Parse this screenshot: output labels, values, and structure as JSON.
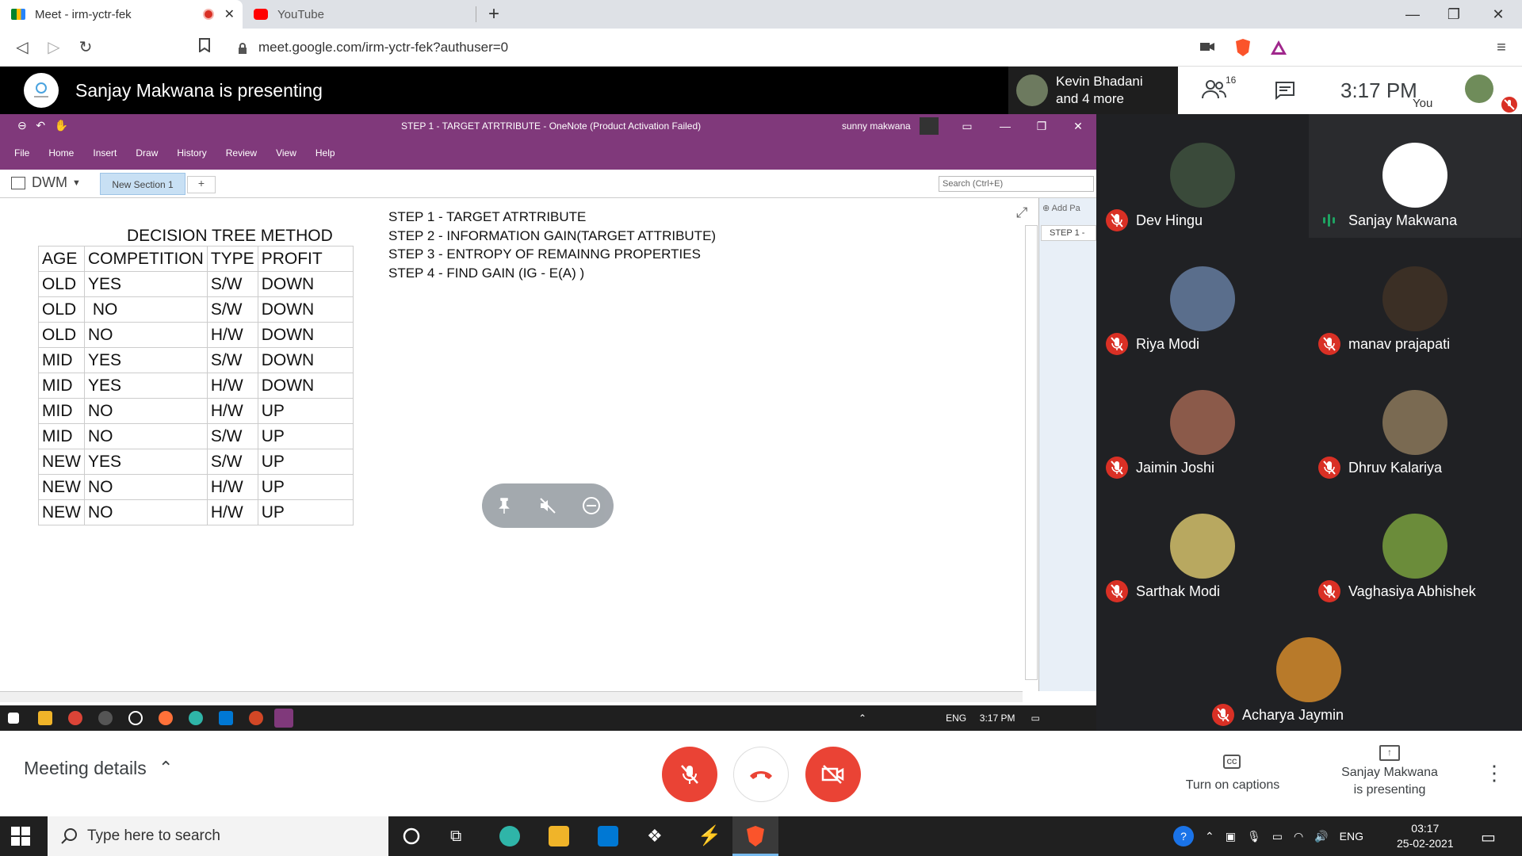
{
  "browser": {
    "tabs": [
      {
        "title": "Meet - irm-yctr-fek"
      },
      {
        "title": "YouTube"
      }
    ],
    "url": "meet.google.com/irm-yctr-fek?authuser=0"
  },
  "meet_header": {
    "presenting_title": "Sanjay Makwana is presenting",
    "pinned_name": "Kevin Bhadani",
    "pinned_more": "and 4 more",
    "people_count": "16",
    "clock": "3:17  PM",
    "you_label": "You"
  },
  "onenote": {
    "title": "STEP 1 -  TARGET ATRTRIBUTE  -  OneNote (Product Activation Failed)",
    "user": "sunny makwana",
    "menu": [
      "File",
      "Home",
      "Insert",
      "Draw",
      "History",
      "Review",
      "View",
      "Help"
    ],
    "notebook": "DWM",
    "section": "New Section 1",
    "search_placeholder": "Search (Ctrl+E)",
    "add_page": "Add Pa",
    "page_tab": "STEP 1 -",
    "page_title": "DECISION TREE METHOD",
    "table": {
      "headers": [
        "AGE",
        "COMPETITION",
        "TYPE",
        "PROFIT"
      ],
      "rows": [
        [
          "OLD",
          "YES",
          "S/W",
          "DOWN"
        ],
        [
          "OLD",
          " NO",
          "S/W",
          "DOWN"
        ],
        [
          "OLD",
          "NO",
          "H/W",
          "DOWN"
        ],
        [
          "MID",
          "YES",
          "S/W",
          "DOWN"
        ],
        [
          "MID",
          "YES",
          "H/W",
          "DOWN"
        ],
        [
          "MID",
          "NO",
          "H/W",
          "UP"
        ],
        [
          "MID",
          "NO",
          "S/W",
          "UP"
        ],
        [
          "NEW",
          "YES",
          "S/W",
          "UP"
        ],
        [
          "NEW",
          "NO",
          "H/W",
          "UP"
        ],
        [
          "NEW",
          "NO",
          "H/W",
          "UP"
        ]
      ]
    },
    "steps": [
      "STEP 1 -  TARGET ATRTRIBUTE",
      "STEP 2 - INFORMATION GAIN(TARGET ATTRIBUTE)",
      "STEP 3 - ENTROPY OF REMAINNG PROPERTIES",
      "STEP 4 - FIND GAIN (IG - E(A) )"
    ],
    "inner_taskbar": {
      "lang": "ENG",
      "time": "3:17 PM"
    }
  },
  "participants": [
    {
      "name": "Dev Hingu",
      "muted": true,
      "color": "#3a4a3a"
    },
    {
      "name": "Sanjay Makwana",
      "muted": false,
      "color": "#ffffff"
    },
    {
      "name": "Riya Modi",
      "muted": true,
      "color": "#5a6e8c"
    },
    {
      "name": "manav prajapati",
      "muted": true,
      "color": "#3b2f25"
    },
    {
      "name": "Jaimin Joshi",
      "muted": true,
      "color": "#8b5a4a"
    },
    {
      "name": "Dhruv Kalariya",
      "muted": true,
      "color": "#7a6a52"
    },
    {
      "name": "Sarthak Modi",
      "muted": true,
      "color": "#b8a860"
    },
    {
      "name": "Vaghasiya Abhishek",
      "muted": true,
      "color": "#6b8c3a"
    },
    {
      "name": "Acharya Jaymin",
      "muted": true,
      "color": "#b87a2a"
    }
  ],
  "bottom_bar": {
    "meeting_details": "Meeting details",
    "captions": "Turn on captions",
    "captions_icon": "CC",
    "presenting_line1": "Sanjay Makwana",
    "presenting_line2": "is presenting"
  },
  "windows_taskbar": {
    "search_placeholder": "Type here to search",
    "lang": "ENG",
    "time": "03:17",
    "date": "25-02-2021"
  }
}
